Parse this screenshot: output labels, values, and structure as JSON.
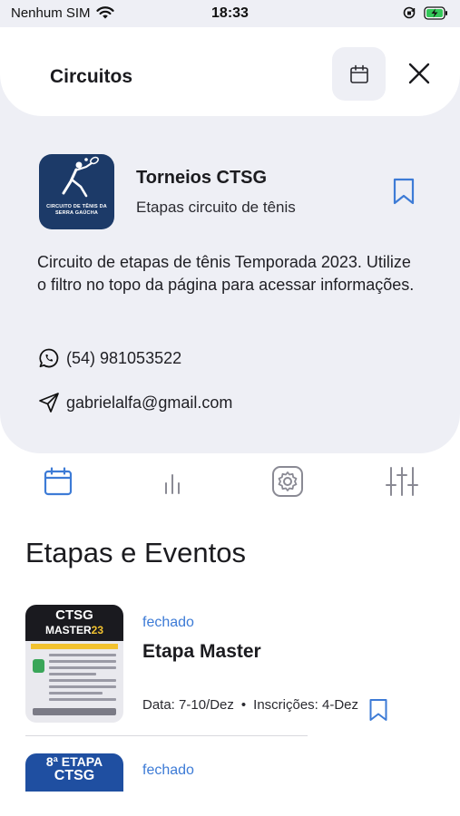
{
  "status_bar": {
    "carrier": "Nenhum SIM",
    "time": "18:33"
  },
  "header": {
    "title": "Circuitos"
  },
  "profile": {
    "name": "Torneios CTSG",
    "subtitle": "Etapas circuito de tênis",
    "logo_text": "CIRCUITO DE TÊNIS DA SERRA GAÚCHA",
    "description": "Circuito de etapas de tênis Temporada 2023. Utilize o filtro no topo da página para acessar informações.",
    "phone": "(54) 981053522",
    "email": "gabrielalfa@gmail.com"
  },
  "tabs": [
    {
      "icon": "calendar-icon",
      "active": true
    },
    {
      "icon": "bar-chart-icon",
      "active": false
    },
    {
      "icon": "gear-icon",
      "active": false
    },
    {
      "icon": "sliders-icon",
      "active": false
    }
  ],
  "section": {
    "title": "Etapas e Eventos"
  },
  "events": [
    {
      "status": "fechado",
      "title": "Etapa Master",
      "date": "Data: 7-10/Dez",
      "inscricoes": "Inscrições: 4-Dez",
      "thumb_line1": "CTSG",
      "thumb_line2a": "MASTER",
      "thumb_line2b": "23"
    },
    {
      "status": "fechado",
      "thumb_line1": "8ª ETAPA",
      "thumb_line2": "CTSG"
    }
  ],
  "colors": {
    "accent_blue": "#3d7bd6",
    "gray_bg": "#eeeff5",
    "logo_navy": "#1c3a68"
  }
}
